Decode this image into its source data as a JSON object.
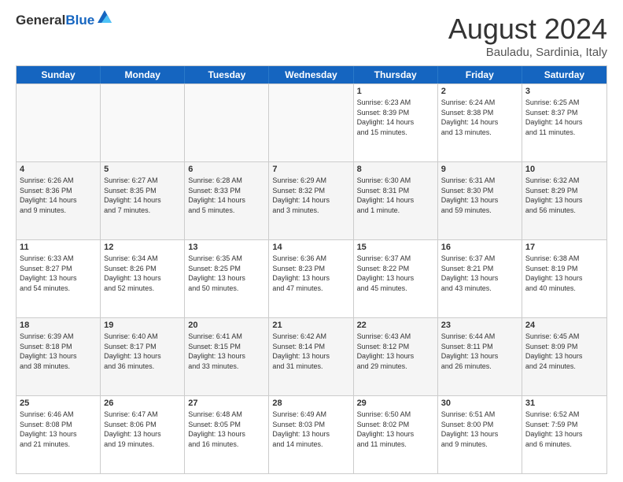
{
  "header": {
    "logo_general": "General",
    "logo_blue": "Blue",
    "month": "August 2024",
    "location": "Bauladu, Sardinia, Italy"
  },
  "weekdays": [
    "Sunday",
    "Monday",
    "Tuesday",
    "Wednesday",
    "Thursday",
    "Friday",
    "Saturday"
  ],
  "rows": [
    [
      {
        "day": "",
        "text": "",
        "empty": true
      },
      {
        "day": "",
        "text": "",
        "empty": true
      },
      {
        "day": "",
        "text": "",
        "empty": true
      },
      {
        "day": "",
        "text": "",
        "empty": true
      },
      {
        "day": "1",
        "text": "Sunrise: 6:23 AM\nSunset: 8:39 PM\nDaylight: 14 hours\nand 15 minutes."
      },
      {
        "day": "2",
        "text": "Sunrise: 6:24 AM\nSunset: 8:38 PM\nDaylight: 14 hours\nand 13 minutes."
      },
      {
        "day": "3",
        "text": "Sunrise: 6:25 AM\nSunset: 8:37 PM\nDaylight: 14 hours\nand 11 minutes."
      }
    ],
    [
      {
        "day": "4",
        "text": "Sunrise: 6:26 AM\nSunset: 8:36 PM\nDaylight: 14 hours\nand 9 minutes."
      },
      {
        "day": "5",
        "text": "Sunrise: 6:27 AM\nSunset: 8:35 PM\nDaylight: 14 hours\nand 7 minutes."
      },
      {
        "day": "6",
        "text": "Sunrise: 6:28 AM\nSunset: 8:33 PM\nDaylight: 14 hours\nand 5 minutes."
      },
      {
        "day": "7",
        "text": "Sunrise: 6:29 AM\nSunset: 8:32 PM\nDaylight: 14 hours\nand 3 minutes."
      },
      {
        "day": "8",
        "text": "Sunrise: 6:30 AM\nSunset: 8:31 PM\nDaylight: 14 hours\nand 1 minute."
      },
      {
        "day": "9",
        "text": "Sunrise: 6:31 AM\nSunset: 8:30 PM\nDaylight: 13 hours\nand 59 minutes."
      },
      {
        "day": "10",
        "text": "Sunrise: 6:32 AM\nSunset: 8:29 PM\nDaylight: 13 hours\nand 56 minutes."
      }
    ],
    [
      {
        "day": "11",
        "text": "Sunrise: 6:33 AM\nSunset: 8:27 PM\nDaylight: 13 hours\nand 54 minutes."
      },
      {
        "day": "12",
        "text": "Sunrise: 6:34 AM\nSunset: 8:26 PM\nDaylight: 13 hours\nand 52 minutes."
      },
      {
        "day": "13",
        "text": "Sunrise: 6:35 AM\nSunset: 8:25 PM\nDaylight: 13 hours\nand 50 minutes."
      },
      {
        "day": "14",
        "text": "Sunrise: 6:36 AM\nSunset: 8:23 PM\nDaylight: 13 hours\nand 47 minutes."
      },
      {
        "day": "15",
        "text": "Sunrise: 6:37 AM\nSunset: 8:22 PM\nDaylight: 13 hours\nand 45 minutes."
      },
      {
        "day": "16",
        "text": "Sunrise: 6:37 AM\nSunset: 8:21 PM\nDaylight: 13 hours\nand 43 minutes."
      },
      {
        "day": "17",
        "text": "Sunrise: 6:38 AM\nSunset: 8:19 PM\nDaylight: 13 hours\nand 40 minutes."
      }
    ],
    [
      {
        "day": "18",
        "text": "Sunrise: 6:39 AM\nSunset: 8:18 PM\nDaylight: 13 hours\nand 38 minutes."
      },
      {
        "day": "19",
        "text": "Sunrise: 6:40 AM\nSunset: 8:17 PM\nDaylight: 13 hours\nand 36 minutes."
      },
      {
        "day": "20",
        "text": "Sunrise: 6:41 AM\nSunset: 8:15 PM\nDaylight: 13 hours\nand 33 minutes."
      },
      {
        "day": "21",
        "text": "Sunrise: 6:42 AM\nSunset: 8:14 PM\nDaylight: 13 hours\nand 31 minutes."
      },
      {
        "day": "22",
        "text": "Sunrise: 6:43 AM\nSunset: 8:12 PM\nDaylight: 13 hours\nand 29 minutes."
      },
      {
        "day": "23",
        "text": "Sunrise: 6:44 AM\nSunset: 8:11 PM\nDaylight: 13 hours\nand 26 minutes."
      },
      {
        "day": "24",
        "text": "Sunrise: 6:45 AM\nSunset: 8:09 PM\nDaylight: 13 hours\nand 24 minutes."
      }
    ],
    [
      {
        "day": "25",
        "text": "Sunrise: 6:46 AM\nSunset: 8:08 PM\nDaylight: 13 hours\nand 21 minutes."
      },
      {
        "day": "26",
        "text": "Sunrise: 6:47 AM\nSunset: 8:06 PM\nDaylight: 13 hours\nand 19 minutes."
      },
      {
        "day": "27",
        "text": "Sunrise: 6:48 AM\nSunset: 8:05 PM\nDaylight: 13 hours\nand 16 minutes."
      },
      {
        "day": "28",
        "text": "Sunrise: 6:49 AM\nSunset: 8:03 PM\nDaylight: 13 hours\nand 14 minutes."
      },
      {
        "day": "29",
        "text": "Sunrise: 6:50 AM\nSunset: 8:02 PM\nDaylight: 13 hours\nand 11 minutes."
      },
      {
        "day": "30",
        "text": "Sunrise: 6:51 AM\nSunset: 8:00 PM\nDaylight: 13 hours\nand 9 minutes."
      },
      {
        "day": "31",
        "text": "Sunrise: 6:52 AM\nSunset: 7:59 PM\nDaylight: 13 hours\nand 6 minutes."
      }
    ]
  ]
}
